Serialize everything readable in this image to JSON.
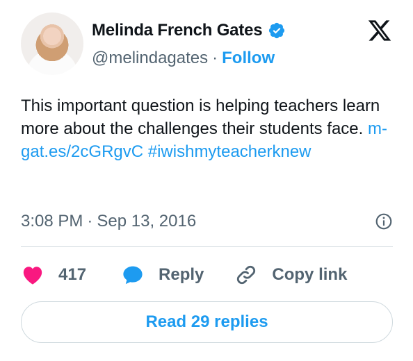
{
  "tweet": {
    "author_name": "Melinda French Gates",
    "handle": "@melindagates",
    "separator": "·",
    "follow_label": "Follow",
    "text_main": "This important question is helping teachers learn more about the challenges their students face.",
    "link": "m-gat.es/2cGRgvC",
    "hashtag": "#iwishmyteacherknew",
    "time": "3:08 PM",
    "date_separator": "·",
    "date": "Sep 13, 2016"
  },
  "actions": {
    "likes_count": "417",
    "reply_label": "Reply",
    "copy_link_label": "Copy link"
  },
  "footer": {
    "read_replies_label": "Read 29 replies"
  },
  "icons": {
    "verified": "verified-badge-icon",
    "brand": "x-logo-icon",
    "info": "info-icon",
    "like": "heart-icon",
    "reply": "speech-bubble-icon",
    "copy": "link-icon"
  },
  "colors": {
    "accent": "#1d9bf0",
    "like": "#f91880",
    "text": "#0f1419",
    "muted": "#536471"
  }
}
